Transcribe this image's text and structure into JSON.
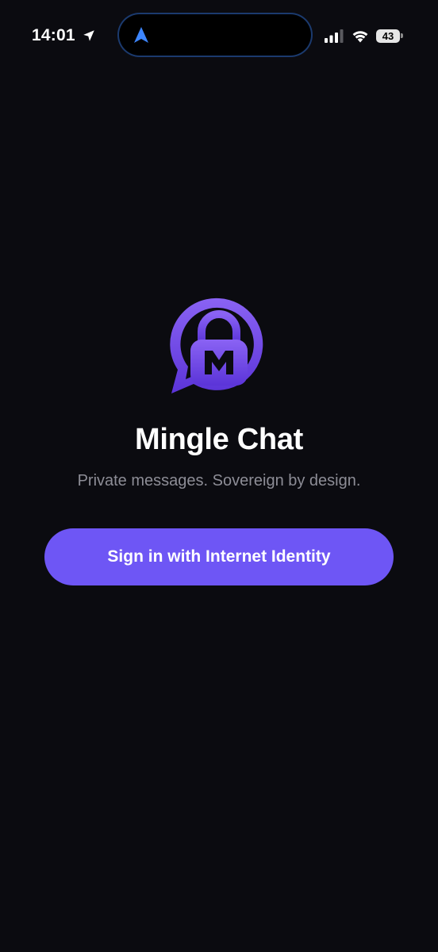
{
  "status_bar": {
    "time": "14:01",
    "battery_level": "43",
    "icons": [
      "location-arrow-icon",
      "navigation-arrow-icon",
      "cellular-signal-icon",
      "wifi-icon",
      "battery-icon"
    ]
  },
  "app": {
    "logo_letter": "M",
    "title": "Mingle Chat",
    "tagline": "Private messages. Sovereign by design.",
    "sign_in_label": "Sign in with Internet Identity"
  },
  "colors": {
    "background": "#0b0b10",
    "accent": "#6e56f5",
    "logo_gradient_top": "#8a63f4",
    "logo_gradient_bottom": "#5b34d8",
    "tagline": "#8d8d96",
    "island_nav": "#3d86ff"
  }
}
